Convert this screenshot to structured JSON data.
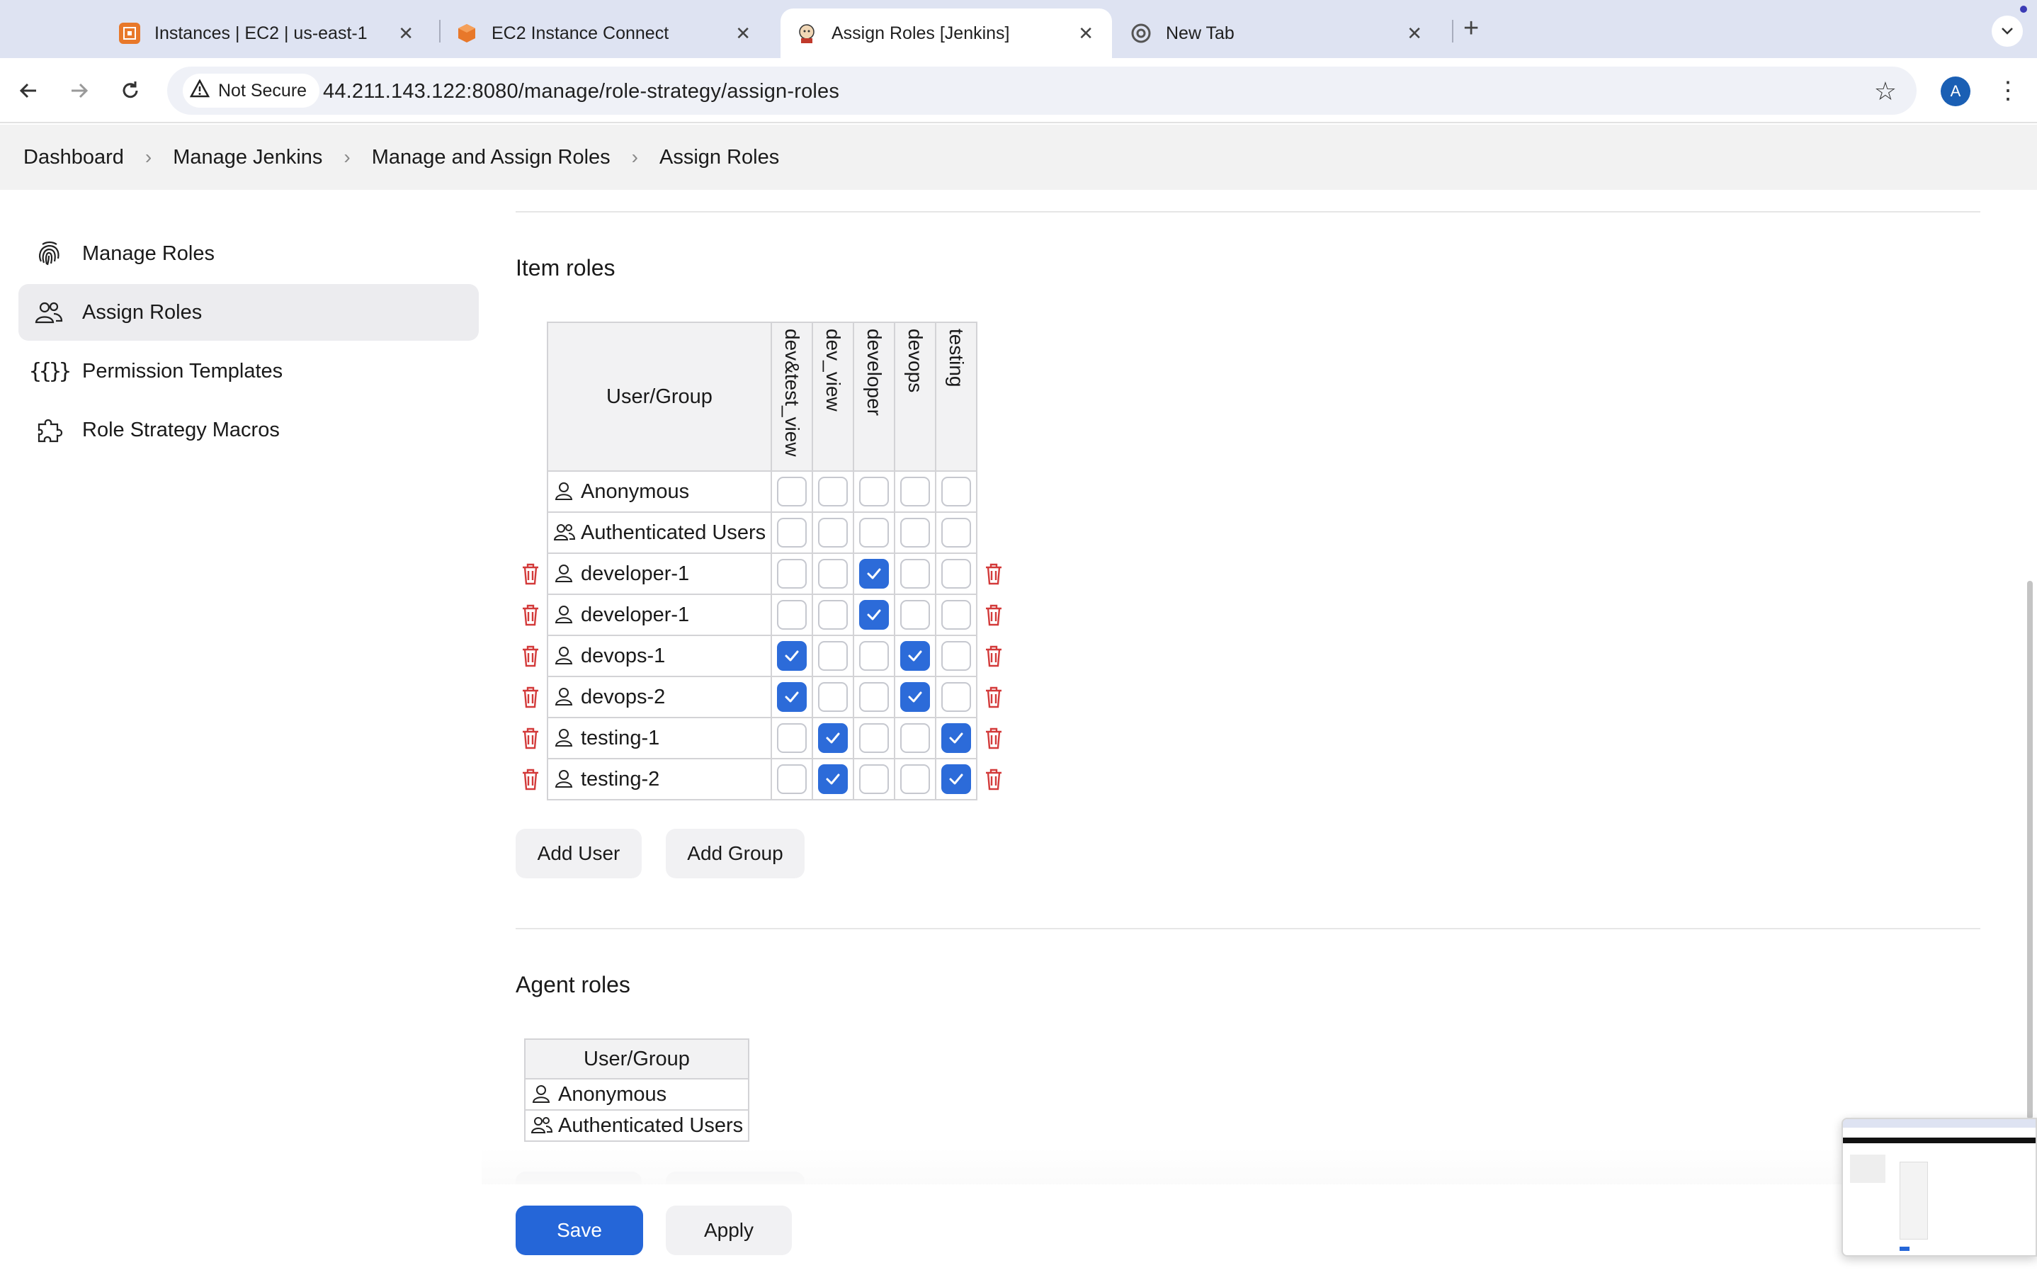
{
  "browser": {
    "tabs": [
      {
        "title": "Instances | EC2 | us-east-1",
        "icon": "aws-ec2-icon"
      },
      {
        "title": "EC2 Instance Connect",
        "icon": "aws-cube-icon"
      },
      {
        "title": "Assign Roles [Jenkins]",
        "icon": "jenkins-icon",
        "active": true
      },
      {
        "title": "New Tab",
        "icon": "chrome-icon"
      }
    ],
    "security_label": "Not Secure",
    "url": "44.211.143.122:8080/manage/role-strategy/assign-roles",
    "avatar_initial": "A"
  },
  "breadcrumbs": [
    "Dashboard",
    "Manage Jenkins",
    "Manage and Assign Roles",
    "Assign Roles"
  ],
  "sidebar": {
    "items": [
      {
        "label": "Manage Roles",
        "icon": "fingerprint-icon"
      },
      {
        "label": "Assign Roles",
        "icon": "users-icon",
        "active": true
      },
      {
        "label": "Permission Templates",
        "icon": "braces-icon"
      },
      {
        "label": "Role Strategy Macros",
        "icon": "puzzle-icon"
      }
    ]
  },
  "item_roles": {
    "title": "Item roles",
    "user_group_header": "User/Group",
    "roles": [
      "dev&test_view",
      "dev_view",
      "developer",
      "devops",
      "testing"
    ],
    "rows": [
      {
        "name": "Anonymous",
        "type": "user",
        "deletable": false,
        "checked": [
          false,
          false,
          false,
          false,
          false
        ]
      },
      {
        "name": "Authenticated Users",
        "type": "group",
        "deletable": false,
        "checked": [
          false,
          false,
          false,
          false,
          false
        ]
      },
      {
        "name": "developer-1",
        "type": "user",
        "deletable": true,
        "checked": [
          false,
          false,
          true,
          false,
          false
        ]
      },
      {
        "name": "developer-1",
        "type": "user",
        "deletable": true,
        "checked": [
          false,
          false,
          true,
          false,
          false
        ]
      },
      {
        "name": "devops-1",
        "type": "user",
        "deletable": true,
        "checked": [
          true,
          false,
          false,
          true,
          false
        ]
      },
      {
        "name": "devops-2",
        "type": "user",
        "deletable": true,
        "checked": [
          true,
          false,
          false,
          true,
          false
        ]
      },
      {
        "name": "testing-1",
        "type": "user",
        "deletable": true,
        "checked": [
          false,
          true,
          false,
          false,
          true
        ]
      },
      {
        "name": "testing-2",
        "type": "user",
        "deletable": true,
        "checked": [
          false,
          true,
          false,
          false,
          true
        ]
      }
    ],
    "add_user_label": "Add User",
    "add_group_label": "Add Group"
  },
  "agent_roles": {
    "title": "Agent roles",
    "user_group_header": "User/Group",
    "rows": [
      {
        "name": "Anonymous",
        "type": "user"
      },
      {
        "name": "Authenticated Users",
        "type": "group"
      }
    ]
  },
  "actions": {
    "save_label": "Save",
    "apply_label": "Apply"
  },
  "colors": {
    "primary": "#2566d8",
    "checkbox_checked": "#2c6bd9",
    "delete_icon": "#d33a3a",
    "breadcrumb_bg": "#f2f2f2",
    "tabbar_bg": "#dee3f2"
  }
}
